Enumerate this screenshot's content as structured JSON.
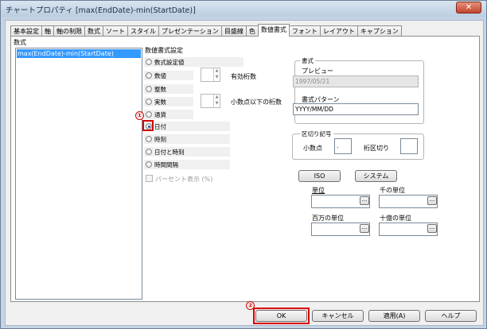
{
  "window": {
    "title": "チャートプロパティ [max(EndDate)-min(StartDate)]",
    "close_glyph": "✕"
  },
  "tabs": [
    {
      "label": "基本設定"
    },
    {
      "label": "軸"
    },
    {
      "label": "軸の制限"
    },
    {
      "label": "数式"
    },
    {
      "label": "ソート"
    },
    {
      "label": "スタイル"
    },
    {
      "label": "プレゼンテーション"
    },
    {
      "label": "目盛線"
    },
    {
      "label": "色"
    },
    {
      "label": "数値書式",
      "active": true
    },
    {
      "label": "フォント"
    },
    {
      "label": "レイアウト"
    },
    {
      "label": "キャプション"
    }
  ],
  "left": {
    "heading": "数式",
    "items": [
      "max(EndDate)-min(StartDate)"
    ]
  },
  "format": {
    "heading": "数値書式設定",
    "options": [
      {
        "label": "数式設定値",
        "checked": false
      },
      {
        "label": "数値",
        "checked": false
      },
      {
        "label": "整数",
        "checked": false
      },
      {
        "label": "実数",
        "checked": false
      },
      {
        "label": "通貨",
        "checked": false
      },
      {
        "label": "日付",
        "checked": true
      },
      {
        "label": "時刻",
        "checked": false
      },
      {
        "label": "日付と時刻",
        "checked": false
      },
      {
        "label": "時間間隔",
        "checked": false
      }
    ],
    "sig_digits_label": "有効桁数",
    "decimal_digits_label": "小数点以下の桁数",
    "percent_label": "パーセント表示 (%)"
  },
  "style_group": {
    "title": "書式",
    "preview_label": "プレビュー",
    "preview_value": "1997/05/21",
    "pattern_label": "書式パターン",
    "pattern_value": "YYYY/MM/DD"
  },
  "separator_group": {
    "title": "区切り記号",
    "decimal_label": "小数点",
    "decimal_value": ".",
    "thousands_label": "桁区切り",
    "thousands_value": ""
  },
  "buttons": {
    "iso": "ISO",
    "system": "システム",
    "ok": "OK",
    "cancel": "キャンセル",
    "apply": "適用(A)",
    "help": "ヘルプ",
    "browse": "..."
  },
  "units": {
    "unit": "単位",
    "thousand": "千の単位",
    "million": "百万の単位",
    "billion": "十億の単位"
  },
  "markers": [
    "①",
    "②"
  ],
  "colors": {
    "highlight": "#d90000",
    "selection": "#3399ff"
  }
}
